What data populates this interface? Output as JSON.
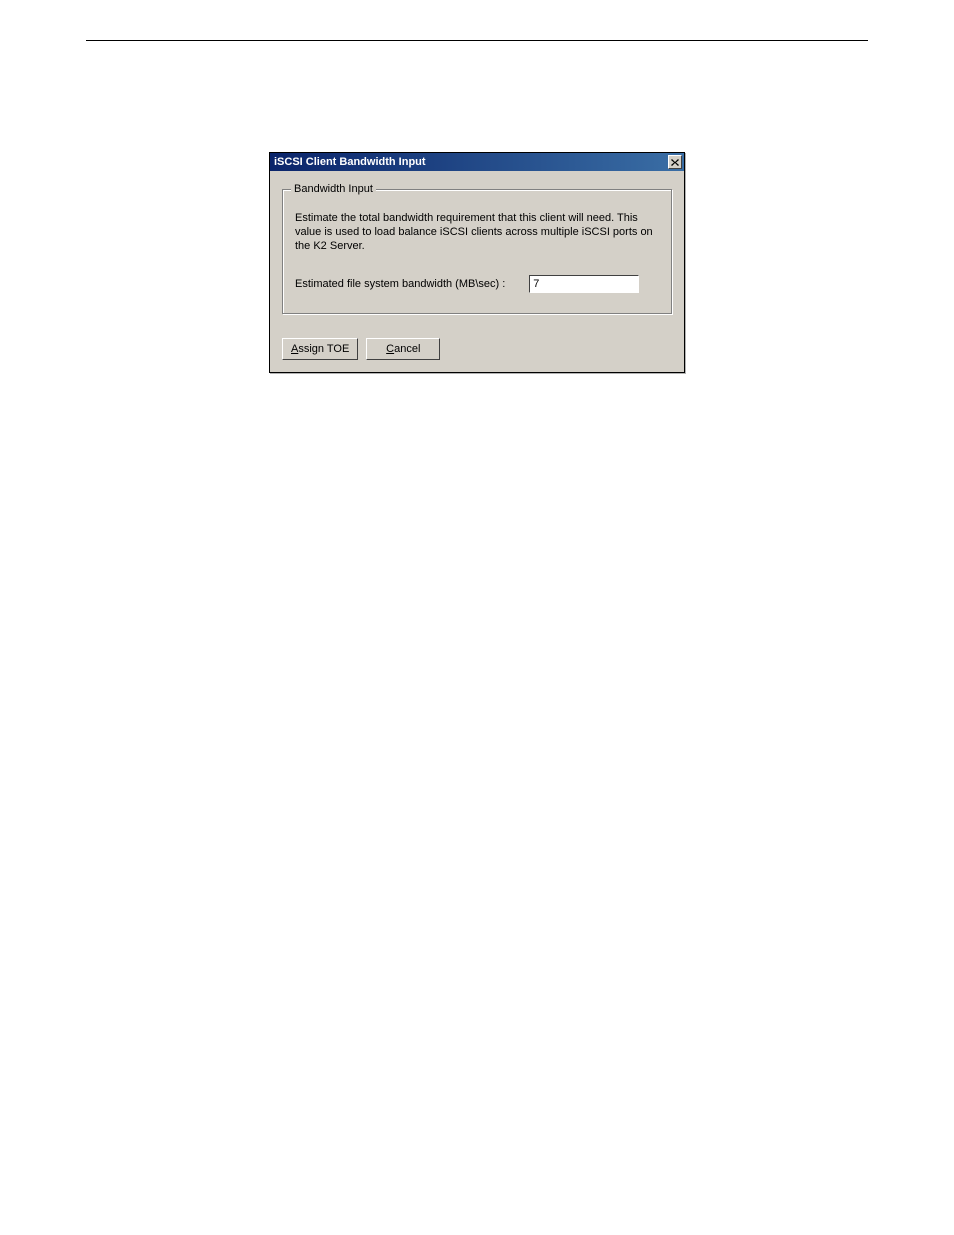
{
  "dialog": {
    "title": "iSCSI Client Bandwidth Input",
    "groupbox": {
      "legend": "Bandwidth Input",
      "description": "Estimate the total bandwidth requirement that this client will need. This value is used to load balance iSCSI clients across multiple iSCSI ports on the K2 Server.",
      "field_label": "Estimated file system bandwidth (MB\\sec) :",
      "field_value": "7"
    },
    "buttons": {
      "assign_pre": "A",
      "assign_post": "ssign TOE",
      "cancel_pre": "C",
      "cancel_post": "ancel"
    }
  }
}
